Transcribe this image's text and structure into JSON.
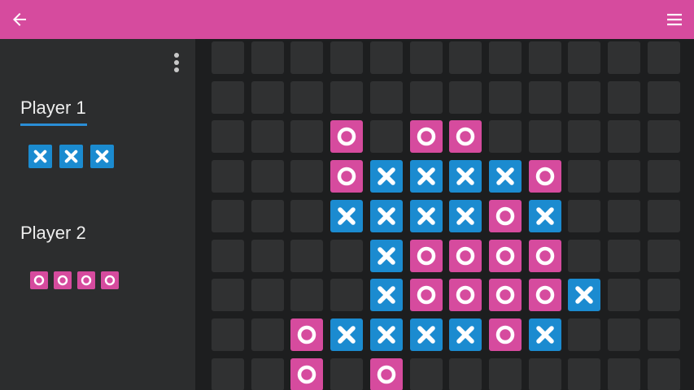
{
  "appbar": {
    "color": "#d64b9e",
    "back_icon": "arrow-left-icon",
    "menu_icon": "hamburger-menu-icon"
  },
  "sidebar": {
    "overflow_icon": "more-vert-icon",
    "player1": {
      "name": "Player 1",
      "mark": "x",
      "pieces_remaining": 3,
      "active": true
    },
    "player2": {
      "name": "Player 2",
      "mark": "o",
      "pieces_remaining": 4,
      "active": false
    }
  },
  "colors": {
    "x": "#1b8bd0",
    "o": "#d64b9e",
    "empty": "#303132",
    "active_underline": "#2a8ed6"
  },
  "board": {
    "columns": 12,
    "rows": [
      "............",
      "............",
      "...O.OO.....",
      "...OXXXXO...",
      "...XXXXOX...",
      "....XOOOO...",
      "....XOOOOX..",
      "..OXXXXOX...",
      "..O.O......."
    ]
  }
}
